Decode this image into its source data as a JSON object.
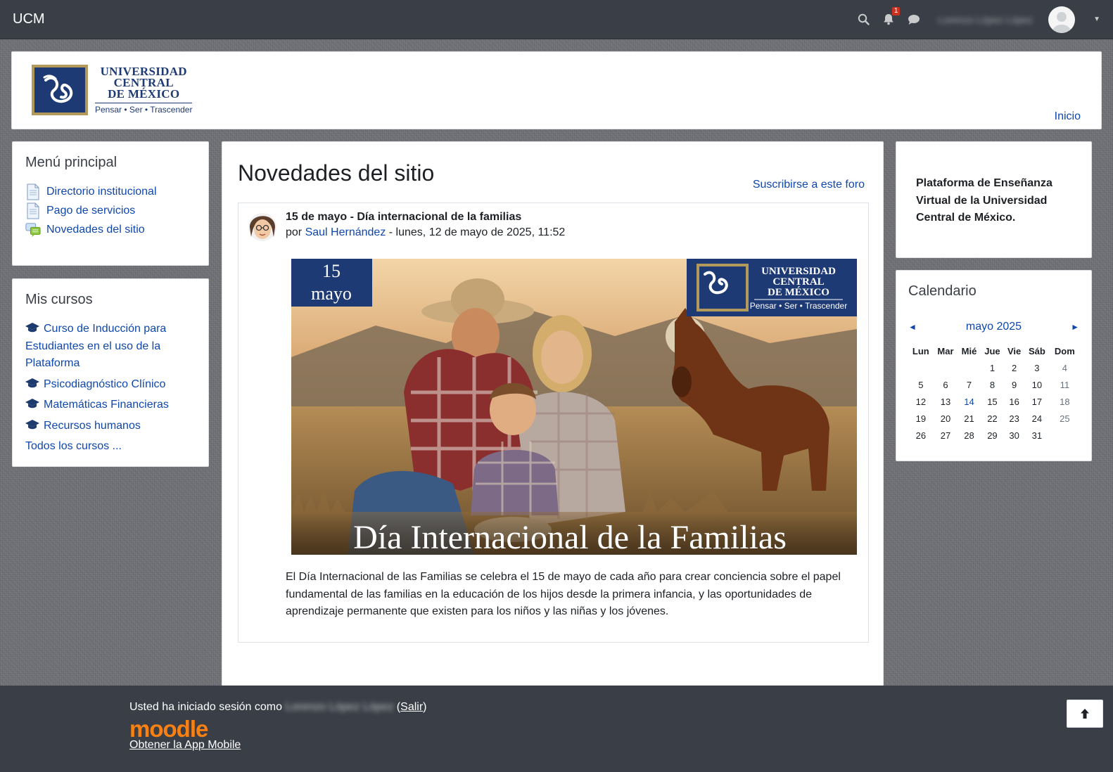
{
  "navbar": {
    "brand": "UCM",
    "notifications_count": "1",
    "user_name": "Lorenzo López López"
  },
  "header": {
    "logo_line1": "UNIVERSIDAD",
    "logo_line2": "CENTRAL",
    "logo_line3": "DE MÉXICO",
    "logo_tagline": "Pensar • Ser • Trascender",
    "home_link": "Inicio"
  },
  "main_menu": {
    "title": "Menú principal",
    "items": [
      {
        "label": "Directorio institucional",
        "icon": "page-icon"
      },
      {
        "label": "Pago de servicios",
        "icon": "page-icon"
      },
      {
        "label": "Novedades del sitio",
        "icon": "forum-icon"
      }
    ]
  },
  "my_courses": {
    "title": "Mis cursos",
    "courses": [
      "Curso de Inducción para Estudiantes en el uso de la Plataforma",
      "Psicodiagnóstico Clínico",
      "Matemáticas Financieras",
      "Recursos humanos"
    ],
    "all_courses": "Todos los cursos ..."
  },
  "forum": {
    "title": "Novedades del sitio",
    "subscribe": "Suscribirse a este foro",
    "post": {
      "subject": "15 de mayo - Día internacional de la familias",
      "by_prefix": "por ",
      "author": "Saul Hernández",
      "date": " - lunes, 12 de mayo de 2025, 11:52",
      "image_date_day": "15",
      "image_date_month": "mayo",
      "image_caption": "Día Internacional de la Familias",
      "image_logo_line1": "UNIVERSIDAD",
      "image_logo_line2": "CENTRAL",
      "image_logo_line3": "DE MÉXICO",
      "image_logo_tagline": "Pensar • Ser • Trascender",
      "body": "El Día Internacional de las Familias se celebra el 15 de mayo de cada año para crear conciencia sobre el papel fundamental de las familias en la educación de los hijos desde la primera infancia, y las oportunidades de aprendizaje permanente que existen para los niños y las niñas y los jóvenes."
    }
  },
  "info_block": {
    "text": "Plataforma de Enseñanza Virtual de la Universidad Central de México."
  },
  "calendar": {
    "title": "Calendario",
    "month": "mayo 2025",
    "prev": "◄",
    "next": "►",
    "weekdays": [
      "Lun",
      "Mar",
      "Mié",
      "Jue",
      "Vie",
      "Sáb",
      "Dom"
    ],
    "weeks": [
      [
        "",
        "",
        "",
        "1",
        "2",
        "3",
        "4"
      ],
      [
        "5",
        "6",
        "7",
        "8",
        "9",
        "10",
        "11"
      ],
      [
        "12",
        "13",
        "14",
        "15",
        "16",
        "17",
        "18"
      ],
      [
        "19",
        "20",
        "21",
        "22",
        "23",
        "24",
        "25"
      ],
      [
        "26",
        "27",
        "28",
        "29",
        "30",
        "31",
        ""
      ]
    ],
    "today": "14"
  },
  "footer": {
    "logged_in_as": "Usted ha iniciado sesión como ",
    "user_name": "Lorenzo López López",
    "logout_open": " (",
    "logout": "Salir",
    "logout_close": ")",
    "moodle": "moodle",
    "app_link": "Obtener la App Mobile"
  },
  "colors": {
    "navbar": "#3a3f47",
    "link": "#0f47ad",
    "brand_blue": "#1e3a74",
    "brand_gold": "#b39a5a",
    "moodle_orange": "#f98012"
  }
}
